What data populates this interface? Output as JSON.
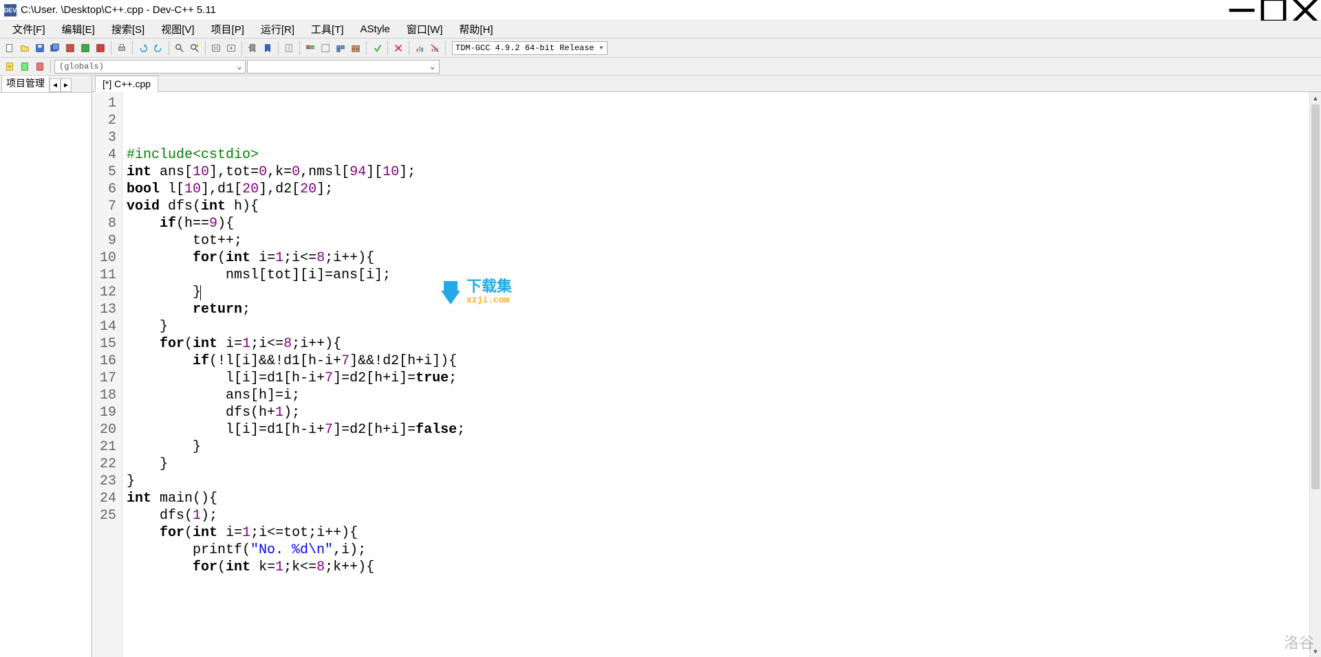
{
  "title": "C:\\User.        \\Desktop\\C++.cpp - Dev-C++ 5.11",
  "menu": [
    "文件[F]",
    "编辑[E]",
    "搜索[S]",
    "视图[V]",
    "项目[P]",
    "运行[R]",
    "工具[T]",
    "AStyle",
    "窗口[W]",
    "帮助[H]"
  ],
  "compiler": "TDM-GCC 4.9.2 64-bit Release",
  "globals": "(globals)",
  "sidebar_tab": "项目管理",
  "editor_tab": "[*] C++.cpp",
  "watermark": {
    "t1": "下载集",
    "t2": "xzji.com"
  },
  "corner": "洛谷",
  "code_lines": [
    {
      "n": 1,
      "txt": "#include<cstdio>",
      "cls": "pp"
    },
    {
      "n": 2,
      "txt": "int ans[10],tot=0,k=0,nmsl[94][10];"
    },
    {
      "n": 3,
      "txt": "bool l[10],d1[20],d2[20];"
    },
    {
      "n": 4,
      "txt": "void dfs(int h){"
    },
    {
      "n": 5,
      "txt": "    if(h==9){"
    },
    {
      "n": 6,
      "txt": "        tot++;"
    },
    {
      "n": 7,
      "txt": "        for(int i=1;i<=8;i++){"
    },
    {
      "n": 8,
      "txt": "            nmsl[tot][i]=ans[i];"
    },
    {
      "n": 9,
      "txt": "        }",
      "caret": true
    },
    {
      "n": 10,
      "txt": "        return;"
    },
    {
      "n": 11,
      "txt": "    }"
    },
    {
      "n": 12,
      "txt": "    for(int i=1;i<=8;i++){"
    },
    {
      "n": 13,
      "txt": "        if(!l[i]&&!d1[h-i+7]&&!d2[h+i]){"
    },
    {
      "n": 14,
      "txt": "            l[i]=d1[h-i+7]=d2[h+i]=true;"
    },
    {
      "n": 15,
      "txt": "            ans[h]=i;"
    },
    {
      "n": 16,
      "txt": "            dfs(h+1);"
    },
    {
      "n": 17,
      "txt": "            l[i]=d1[h-i+7]=d2[h+i]=false;"
    },
    {
      "n": 18,
      "txt": "        }"
    },
    {
      "n": 19,
      "txt": "    }"
    },
    {
      "n": 20,
      "txt": "}"
    },
    {
      "n": 21,
      "txt": "int main(){"
    },
    {
      "n": 22,
      "txt": "    dfs(1);"
    },
    {
      "n": 23,
      "txt": "    for(int i=1;i<=tot;i++){"
    },
    {
      "n": 24,
      "txt": "        printf(\"No. %d\\n\",i);"
    },
    {
      "n": 25,
      "txt": "        for(int k=1;k<=8;k++){"
    }
  ]
}
